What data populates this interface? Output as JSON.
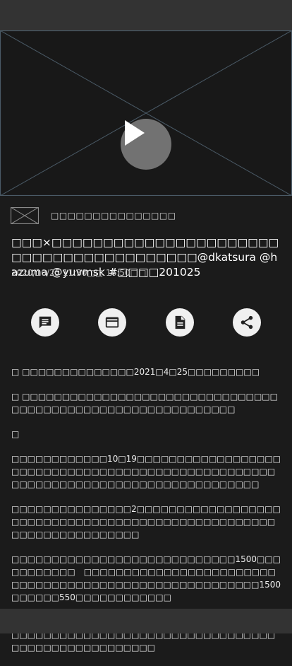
{
  "video": {
    "play_icon": "play-icon",
    "placeholder_icon": "image-placeholder-icon"
  },
  "channel": {
    "name": "□□□□□□□□□□□□□□□",
    "thumb_icon": "channel-thumbnail-icon"
  },
  "program": {
    "title": "□□□×□□□□□□□□□□□□□□□□□□□□□□□□□□□□□□□□□□□□□□□□@dkatsura @hazuma @yuvmsk #□□□□201025",
    "dates": "2020/10/25 11:30□□ 16:50□□"
  },
  "actions": [
    {
      "name": "comment-button",
      "icon": "comment-icon"
    },
    {
      "name": "card-button",
      "icon": "credit-card-icon"
    },
    {
      "name": "document-button",
      "icon": "document-icon"
    },
    {
      "name": "share-button",
      "icon": "share-icon"
    }
  ],
  "description": [
    "□ □□□□□□□□□□□□□□2021□4□25□□□□□□□□□",
    "□ □□□□□□□□□□□□□□□□□□□□□□□□□□□□□□□□□□□□□□□□□□□□□□□□□□□□□□□□□□□□",
    "□",
    "□□□□□□□□□□□□10□19□□□□□□□□□□□□□□□□□□□□□□□□□□□□□□□□□□□□□□□□□□□□□□□□□□□□□□□□□□□□□□□□□□□□□□□□□□□□□□□□□□",
    "□□□□□□□□□□□□□□□2□□□□□□□□□□□□□□□□□□□□□□□□□□□□□□□□□□□□□□□□□□□□□□□□□□□□□□□□□□□□□□□□□□□",
    "□□□□□□□□□□□□□□□□□□□□□□□□□□□□1500□□□□□□□□□□□　□□□□□□□□□□□□□□□□□□□□□□□□□□□□□□□□□□□□□□□□□□□□□□□□□□□□□□□1500□□□□□□550□□□□□□□□□□□□",
    "□□□□□□□□□□□□□□□□□□□□□□□□□□□□□□□□□□□□□□□□□□□□□□□□□□□□□□□□□□□□□□□□□□□□□□□□□□□□□□□□□□□□"
  ]
}
